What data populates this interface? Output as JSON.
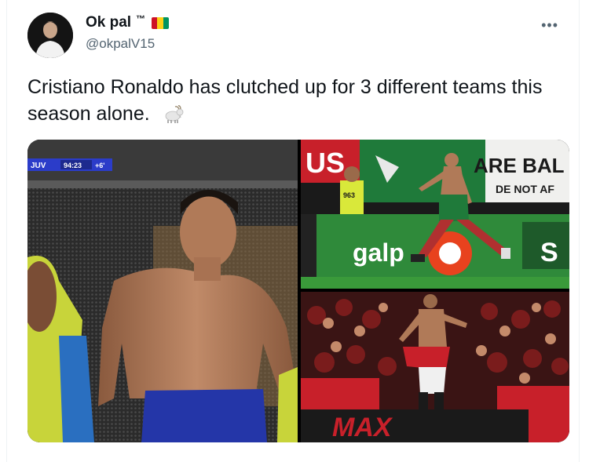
{
  "tweet": {
    "display_name": "Ok pal",
    "tm": "™",
    "handle": "@okpalV15",
    "more": "•••",
    "text": "Cristiano Ronaldo has clutched up for 3 different teams this season alone.",
    "emoji_icon": "goat-icon",
    "flag_colors": [
      "#ce1126",
      "#fcd116",
      "#009460"
    ]
  },
  "media": {
    "left": {
      "scoreboard_team": "JUV",
      "scoreboard_time": "94:23",
      "scoreboard_added": "+6'"
    },
    "top_right": {
      "banner_fragment_1": "US",
      "banner_fragment_2": "ARE BAL",
      "banner_fragment_3": "DE NOT AF",
      "ad_text": "galp",
      "ad_letter": "S",
      "vest_number": "963"
    },
    "bottom_right": {
      "ad_text": "MAX"
    }
  }
}
